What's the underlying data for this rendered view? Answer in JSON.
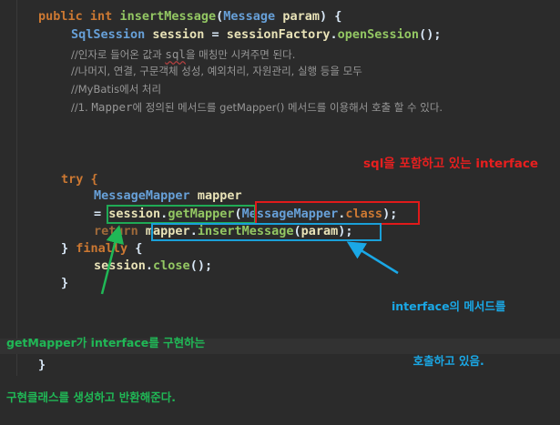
{
  "code": {
    "signature": {
      "kw_public": "public",
      "kw_int": "int",
      "method": "insertMessage",
      "paren_open": "(",
      "param_type": "Message",
      "param_name": "param",
      "paren_close": ") {"
    },
    "session_line": {
      "type": "SqlSession",
      "var": "session",
      "eq": " = ",
      "factory": "sessionFactory",
      "dot": ".",
      "call": "openSession",
      "end": "();"
    },
    "comments": [
      {
        "a": "//인자로 들어온 값과 ",
        "mono": "sql",
        "b": "을 매칭만 시켜주면 된다."
      },
      {
        "a": "//나머지, 연결, 구문객체 성성, 예외처리, 자원관리, 실행 등을 모두",
        "mono": "",
        "b": ""
      },
      {
        "a": "//MyBatis에서 처리",
        "mono": "",
        "b": ""
      },
      {
        "a": "//1. ",
        "mono": "Mapper",
        "b": "에 정의된 메서드를 getMapper() 메서드를 이용해서 호출 할 수 있다."
      }
    ],
    "try_line": "try {",
    "mapper_decl": {
      "type": "MessageMapper",
      "var": "mapper"
    },
    "assign_line": {
      "eq": "= ",
      "session": "session",
      "dot": ".",
      "get_mapper": "getMapper",
      "paren_open": "(",
      "mapper_type": "MessageMapper",
      "class_dot": ".",
      "kw_class": "class",
      "paren_close": ")",
      "semi": ";"
    },
    "return_line": {
      "kw_return": "return",
      "mapper": "mapper",
      "dot": ".",
      "call": "insertMessage",
      "paren_open": "(",
      "arg": "param",
      "end": ");"
    },
    "finally_line": {
      "brace": "} ",
      "kw_finally": "finally",
      "open": " {"
    },
    "close_line": {
      "session": "session",
      "dot": ".",
      "call": "close",
      "end": "();"
    },
    "close_brace_inner": "}",
    "close_brace_outer": "}"
  },
  "annotations": {
    "red": "sql을 포함하고 있는 interface",
    "blue_line1": "interface의 메서드를",
    "blue_line2": "호출하고 있음.",
    "green_line1": "getMapper가 interface를 구현하는",
    "green_line2": "구현클래스를 생성하고 반환해준다."
  },
  "colors": {
    "background": "#2b2b2b",
    "keyword": "#cc7832",
    "method": "#93c763",
    "type": "#67a0d8",
    "identifier": "#e8e2b7",
    "comment": "#969696",
    "annotation_red": "#e81f1f",
    "annotation_blue": "#1aa8e6",
    "annotation_green": "#20b856"
  }
}
